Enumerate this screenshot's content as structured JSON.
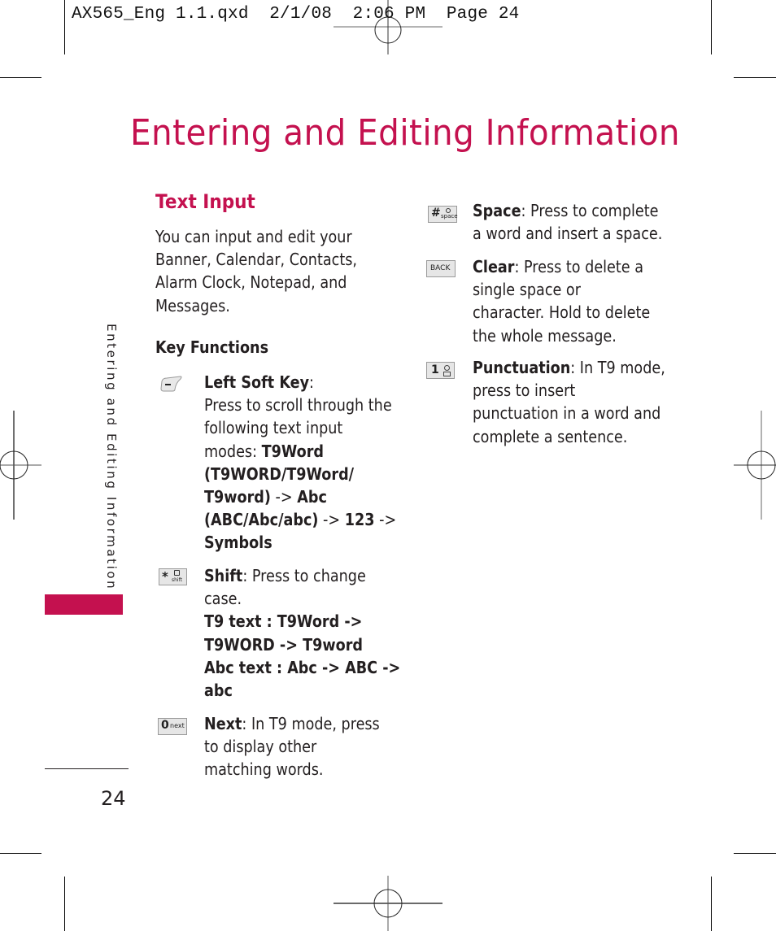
{
  "print_slug": {
    "filename": "AX565_Eng 1.1.qxd",
    "date": "2/1/08",
    "time": "2:06 PM",
    "page_label": "Page 24",
    "full_text": "AX565_Eng 1.1.qxd  2/1/08  2:06 PM  Page 24"
  },
  "page": {
    "title": "Entering and Editing Information",
    "side_tab": "Entering and Editing Information",
    "page_number": "24",
    "accent_color": "#c4114f"
  },
  "section": {
    "heading": "Text Input",
    "intro_lines": [
      "You can input and edit your",
      "Banner, Calendar, Contacts,",
      "Alarm Clock, Notepad, and",
      "Messages."
    ],
    "subheading": "Key Functions"
  },
  "key_functions": {
    "left_soft_key": {
      "icon": "left-soft-key-icon",
      "name": "Left Soft Key",
      "colon": ":",
      "line1": "Press to scroll through the",
      "line2": "following text input",
      "line3_plain": "modes: ",
      "line3_bold": "T9Word",
      "line4_bold": "(T9WORD/T9Word/",
      "line5_bold": "T9word)",
      "line5_plain": " -> ",
      "line5_bold2": "Abc",
      "line6_bold": "(ABC/Abc/abc)",
      "line6_plain": " -> ",
      "line6_bold2": "123",
      "line6_plain2": " ->",
      "line7_bold": "Symbols"
    },
    "shift": {
      "icon": "star-shift-key-icon",
      "icon_label_main": "*",
      "icon_label_sub": "shift",
      "name": "Shift",
      "desc_first": ": Press to change",
      "desc_second": "case.",
      "t9_line1": "T9 text : T9Word ->",
      "t9_line2": "T9WORD -> T9word",
      "abc_line1": "Abc text : Abc -> ABC ->",
      "abc_line2": "abc"
    },
    "next": {
      "icon": "zero-next-key-icon",
      "icon_label_main": "0",
      "icon_label_sub": "next",
      "name": "Next",
      "desc_first": ": In T9 mode, press",
      "desc_lines": [
        "to display other",
        "matching words."
      ]
    },
    "space": {
      "icon": "hash-space-key-icon",
      "icon_label_main": "#",
      "icon_label_sub": "space",
      "name": "Space",
      "desc_first": ": Press to complete",
      "desc_lines": [
        "a word and insert a space."
      ]
    },
    "clear": {
      "icon": "back-key-icon",
      "icon_label_main": "BACK",
      "name": "Clear",
      "desc_first": ": Press to delete a",
      "desc_lines": [
        "single space or",
        "character. Hold to delete",
        "the whole message."
      ]
    },
    "punctuation": {
      "icon": "one-voicemail-key-icon",
      "icon_label_main": "1",
      "name": "Punctuation",
      "desc_first": ": In T9 mode,",
      "desc_lines": [
        "press to insert",
        "punctuation in a word and",
        "complete a sentence."
      ]
    }
  }
}
